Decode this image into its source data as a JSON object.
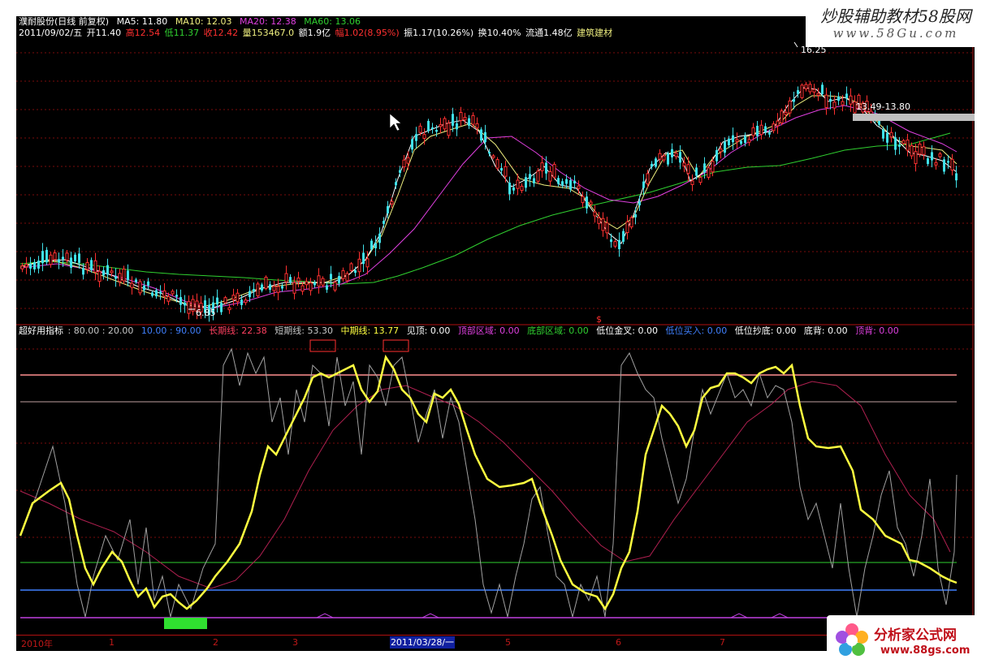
{
  "header": {
    "stock_name": "濮耐股份(日线 前复权)",
    "ma5": "MA5: 11.80",
    "ma10": "MA10: 12.03",
    "ma20": "MA20: 12.38",
    "ma60": "MA60: 13.06",
    "date": "2011/09/02/五",
    "open": "开11.40",
    "high": "高12.54",
    "low": "低11.37",
    "close": "收12.42",
    "volume": "量153467.0",
    "amount": "额1.9亿",
    "change": "幅1.02(8.95%)",
    "amplitude": "振1.17(10.26%)",
    "turnover": "换10.40%",
    "float": "流通1.48亿",
    "industry": "建筑建材"
  },
  "price_panel": {
    "high_label": "16.25",
    "low_label": "6.85",
    "mid_label": "13.49-13.80",
    "marker": "$"
  },
  "indicator": {
    "name": "超好用指标",
    "params": ": 80.00 : 20.00",
    "params2": "10.00 : 90.00",
    "long_line": "长期线: 22.38",
    "short_line": "短期线: 53.30",
    "mid_line": "中期线: 13.77",
    "top_see": "见顶: 0.00",
    "top_zone": "顶部区域: 0.00",
    "bottom_zone": "底部区域: 0.00",
    "low_cross": "低位金叉: 0.00",
    "low_buy": "低位买入: 0.00",
    "low_bottom": "低位抄底: 0.00",
    "bottom_div": "底背: 0.00",
    "top_div": "顶背: 0.00"
  },
  "datebar": {
    "year": "2010年",
    "m1": "1",
    "m2": "2",
    "m3": "3",
    "selected": "2011/03/28/一",
    "m5": "5",
    "m6": "6",
    "m7": "7"
  },
  "watermark_top": {
    "line1": "炒股辅助教材58股网",
    "line2": "www.58Gu.com"
  },
  "watermark_bottom": {
    "line1": "分析家公式网",
    "line2": "www.88gs.com"
  },
  "colors": {
    "up": "#ff3030",
    "down": "#40e0e8",
    "ma5": "#ffffff",
    "ma10": "#f0f080",
    "ma20": "#e040e0",
    "ma60": "#30d030",
    "yellow": "#ffff40"
  }
}
